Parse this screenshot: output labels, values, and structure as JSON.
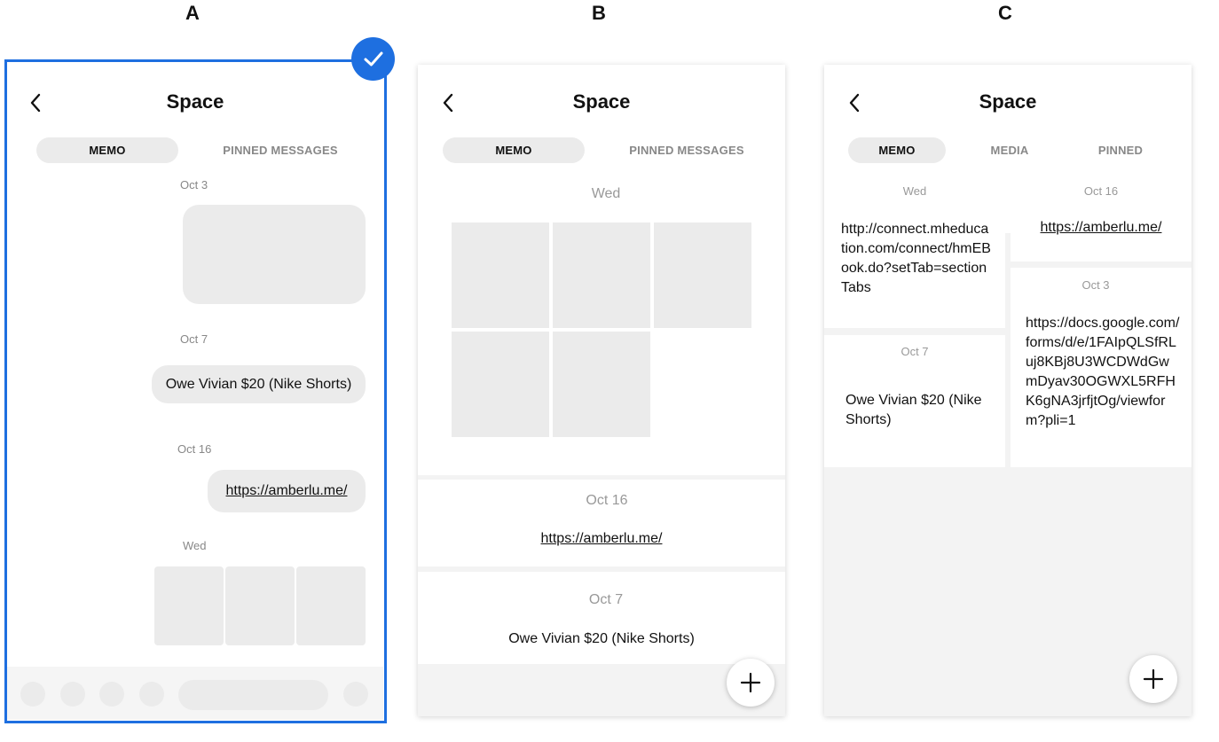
{
  "labels": {
    "a": "A",
    "b": "B",
    "c": "C"
  },
  "colors": {
    "selection": "#1e6fe0",
    "placeholder": "#ebebeb",
    "muted_text": "#888888"
  },
  "icons": {
    "back": "chevron-left-icon",
    "check": "checkmark-icon",
    "add": "plus-icon"
  },
  "a": {
    "title": "Space",
    "tabs": [
      "MEMO",
      "PINNED MESSAGES"
    ],
    "messages": {
      "d1": "Oct 3",
      "d2": "Oct 7",
      "m2": "Owe Vivian $20 (Nike Shorts)",
      "d3": "Oct 16",
      "m3": "https://amberlu.me/",
      "d4": "Wed"
    }
  },
  "b": {
    "title": "Space",
    "tabs": [
      "MEMO",
      "PINNED MESSAGES"
    ],
    "cards": [
      {
        "date": "Wed"
      },
      {
        "date": "Oct 16",
        "text": "https://amberlu.me/"
      },
      {
        "date": "Oct 7",
        "text": "Owe Vivian $20 (Nike Shorts)"
      }
    ]
  },
  "c": {
    "title": "Space",
    "tabs": [
      "MEMO",
      "MEDIA",
      "PINNED"
    ],
    "cards": [
      {
        "date": "Wed",
        "text": "http://connect.mheducation.com/connect/hmEBook.do?setTab=sectionTabs"
      },
      {
        "date": "Oct 16",
        "text": "https://amberlu.me/"
      },
      {
        "date": "Oct 7",
        "text": "Owe Vivian $20 (Nike Shorts)"
      },
      {
        "date": "Oct 3",
        "text": "https://docs.google.com/forms/d/e/1FAIpQLSfRLuj8KBj8U3WCDWdGwmDyav30OGWXL5RFHK6gNA3jrfjtOg/viewform?pli=1"
      }
    ]
  }
}
